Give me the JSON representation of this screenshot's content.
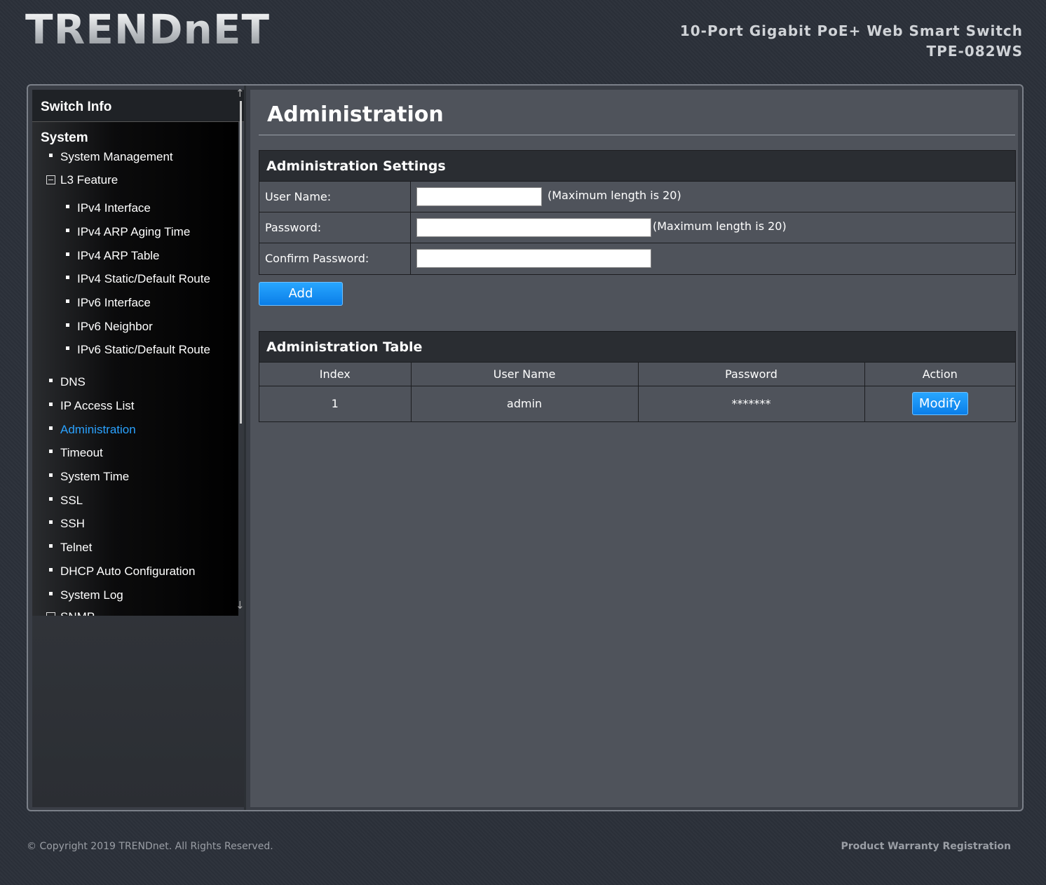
{
  "brand": {
    "logo_text": "TRENDnET"
  },
  "product": {
    "name": "10-Port Gigabit PoE+ Web Smart Switch",
    "model": "TPE-082WS"
  },
  "sidebar": {
    "header": "Switch Info",
    "section": "System",
    "items": [
      {
        "label": "System Management"
      },
      {
        "label": "L3 Feature"
      },
      {
        "label": "IPv4 Interface"
      },
      {
        "label": "IPv4 ARP Aging Time"
      },
      {
        "label": "IPv4 ARP Table"
      },
      {
        "label": "IPv4 Static/Default Route"
      },
      {
        "label": "IPv6 Interface"
      },
      {
        "label": "IPv6 Neighbor"
      },
      {
        "label": "IPv6 Static/Default Route"
      },
      {
        "label": "DNS"
      },
      {
        "label": "IP Access List"
      },
      {
        "label": "Administration"
      },
      {
        "label": "Timeout"
      },
      {
        "label": "System Time"
      },
      {
        "label": "SSL"
      },
      {
        "label": "SSH"
      },
      {
        "label": "Telnet"
      },
      {
        "label": "DHCP Auto Configuration"
      },
      {
        "label": "System Log"
      },
      {
        "label": "SNMP"
      }
    ]
  },
  "main": {
    "title": "Administration",
    "settings": {
      "heading": "Administration Settings",
      "user_name_label": "User Name:",
      "user_name_value": "",
      "user_name_hint": "(Maximum length is 20)",
      "password_label": "Password:",
      "password_value": "",
      "password_hint": "(Maximum length is 20)",
      "confirm_label": "Confirm Password:",
      "confirm_value": "",
      "add_label": "Add"
    },
    "table": {
      "heading": "Administration Table",
      "columns": [
        "Index",
        "User Name",
        "Password",
        "Action"
      ],
      "rows": [
        {
          "index": "1",
          "user_name": "admin",
          "password": "*******",
          "action": "Modify"
        }
      ]
    }
  },
  "footer": {
    "copyright": "© Copyright 2019 TRENDnet. All Rights Reserved.",
    "warranty_link": "Product Warranty Registration"
  },
  "colors": {
    "accent": "#2aa2ff",
    "button": "#0a7ee8",
    "content_bg": "#4f535b"
  }
}
